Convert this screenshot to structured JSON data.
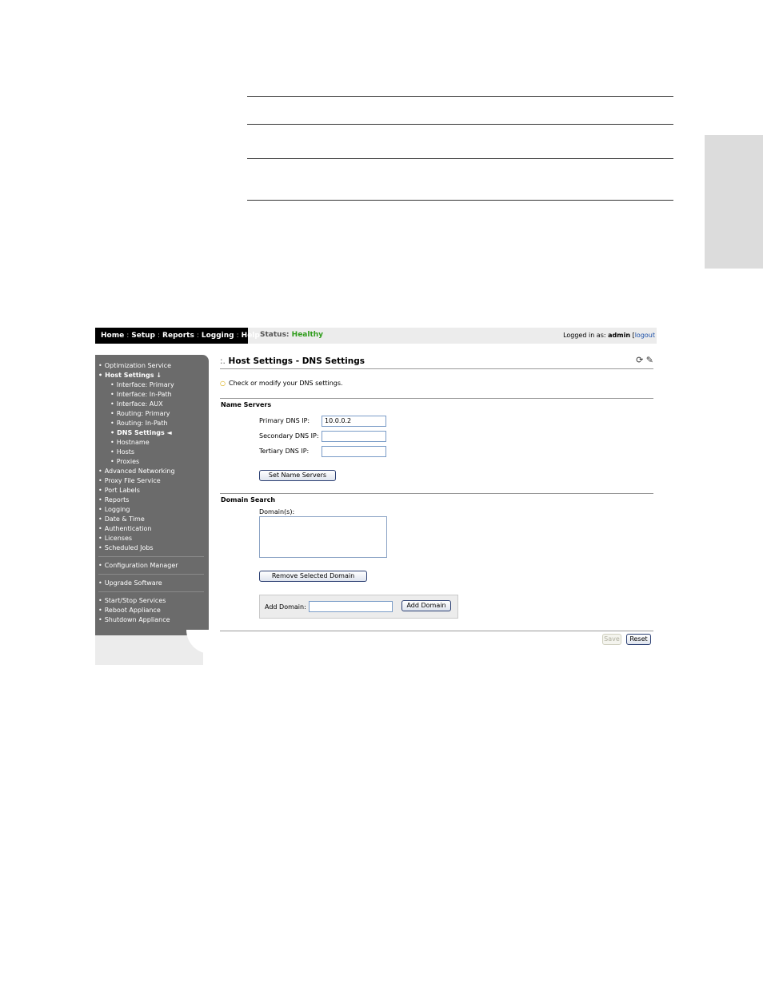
{
  "navbar": {
    "items": [
      "Home",
      "Setup",
      "Reports",
      "Logging",
      "Help"
    ],
    "active": "Setup"
  },
  "status": {
    "label": "Status:",
    "value": "Healthy",
    "value_color": "#2e9c1a"
  },
  "login": {
    "prefix": "Logged in as:",
    "user": "admin",
    "bracket": "[",
    "logout": "logout"
  },
  "sidebar": {
    "group1": [
      {
        "label": "Optimization Service",
        "level": 0
      },
      {
        "label": "Host Settings ↓",
        "level": 0,
        "bold": true
      },
      {
        "label": "Interface: Primary",
        "level": 1
      },
      {
        "label": "Interface: In-Path",
        "level": 1
      },
      {
        "label": "Interface: AUX",
        "level": 1
      },
      {
        "label": "Routing: Primary",
        "level": 1
      },
      {
        "label": "Routing: In-Path",
        "level": 1
      },
      {
        "label": "DNS Settings ◄",
        "level": 1,
        "bold": true
      },
      {
        "label": "Hostname",
        "level": 1
      },
      {
        "label": "Hosts",
        "level": 1
      },
      {
        "label": "Proxies",
        "level": 1
      },
      {
        "label": "Advanced Networking",
        "level": 0
      },
      {
        "label": "Proxy File Service",
        "level": 0
      },
      {
        "label": "Port Labels",
        "level": 0
      },
      {
        "label": "Reports",
        "level": 0
      },
      {
        "label": "Logging",
        "level": 0
      },
      {
        "label": "Date & Time",
        "level": 0
      },
      {
        "label": "Authentication",
        "level": 0
      },
      {
        "label": "Licenses",
        "level": 0
      },
      {
        "label": "Scheduled Jobs",
        "level": 0
      }
    ],
    "group2": [
      "Configuration Manager"
    ],
    "group3": [
      "Upgrade Software"
    ],
    "group4": [
      "Start/Stop Services",
      "Reboot Appliance",
      "Shutdown Appliance"
    ]
  },
  "page": {
    "title_prefix": ":.",
    "title": "Host Settings - DNS Settings",
    "tip": "Check or modify your DNS settings."
  },
  "name_servers": {
    "heading": "Name Servers",
    "primary_label": "Primary DNS IP:",
    "primary_value": "10.0.0.2",
    "secondary_label": "Secondary DNS IP:",
    "secondary_value": "",
    "tertiary_label": "Tertiary DNS IP:",
    "tertiary_value": "",
    "set_button": "Set Name Servers"
  },
  "domain_search": {
    "heading": "Domain Search",
    "domains_label": "Domain(s):",
    "domains": [],
    "remove_button": "Remove Selected Domain",
    "add_label": "Add Domain:",
    "add_value": "",
    "add_button": "Add Domain"
  },
  "footer": {
    "save": "Save",
    "reset": "Reset"
  }
}
